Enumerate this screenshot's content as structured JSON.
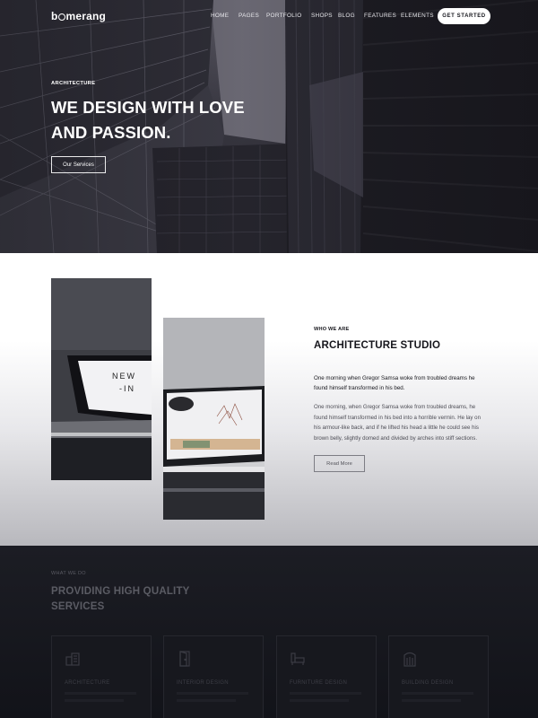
{
  "header": {
    "logo": "boomerang",
    "nav": [
      "HOME",
      "PAGES",
      "PORTFOLIO",
      "SHOPS",
      "BLOG",
      "FEATURES",
      "ELEMENTS"
    ],
    "cta": "GET STARTED"
  },
  "hero": {
    "kicker": "ARCHITECTURE",
    "title": "WE DESIGN WITH LOVE AND PASSION.",
    "button": "Our Services"
  },
  "about": {
    "kicker": "WHO WE ARE",
    "title": "ARCHITECTURE STUDIO",
    "lead": "One morning when Gregor Samsa woke from troubled dreams he found himself transformed in his bed.",
    "body": "One morning, when Gregor Samsa woke from troubled dreams, he found himself transformed in his bed into a horrible vermin. He lay on his armour-like back, and if he lifted his head a little he could see his brown belly, slightly domed and divided by arches into stiff sections.",
    "button": "Read More",
    "screen_text": "NEW -IN"
  },
  "services": {
    "kicker": "WHAT WE DO",
    "title": "PROVIDING HIGH QUALITY SERVICES",
    "cards": [
      {
        "label": "ARCHITECTURE",
        "icon": "building-icon"
      },
      {
        "label": "INTERIOR DESIGN",
        "icon": "door-icon"
      },
      {
        "label": "FURNITURE DESIGN",
        "icon": "furniture-icon"
      },
      {
        "label": "BUILDING DESIGN",
        "icon": "skyscraper-icon"
      }
    ]
  },
  "colors": {
    "dark": "#15161c",
    "white": "#ffffff",
    "muted": "#5b5c64"
  }
}
